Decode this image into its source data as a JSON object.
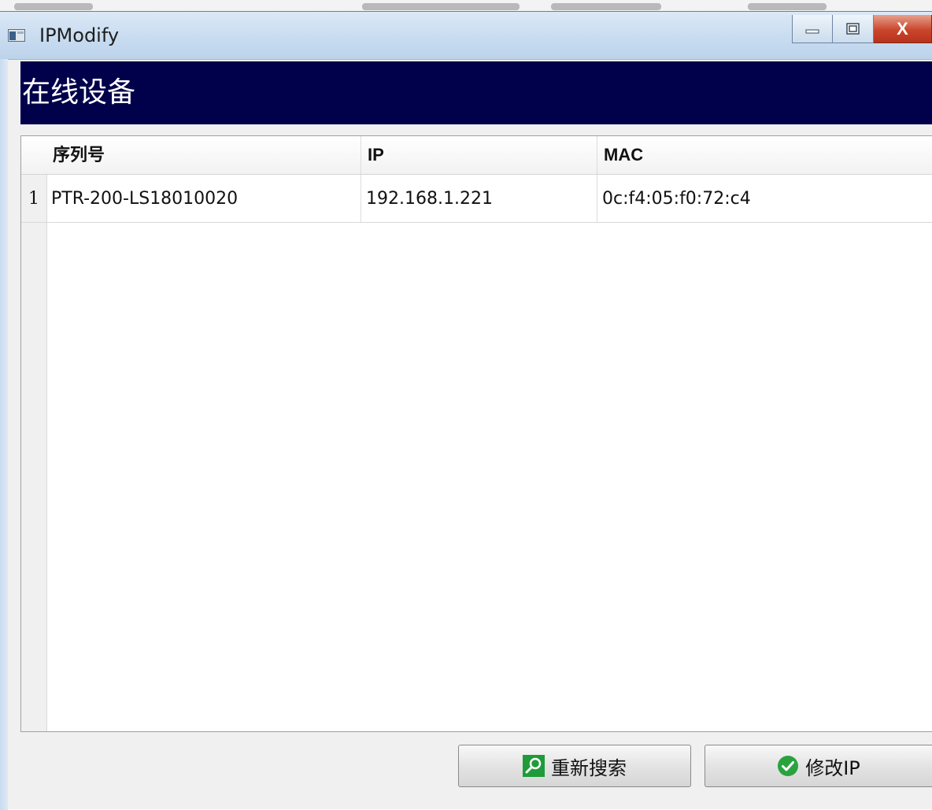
{
  "window": {
    "title": "IPModify",
    "close_glyph": "X"
  },
  "header": {
    "title": "在线设备"
  },
  "table": {
    "columns": [
      "序列号",
      "IP",
      "MAC"
    ],
    "rows": [
      {
        "index": "1",
        "serial": "PTR-200-LS18010020",
        "ip": "192.168.1.221",
        "mac": "0c:f4:05:f0:72:c4"
      }
    ]
  },
  "buttons": {
    "research_label": "重新搜索",
    "modify_label": "修改IP"
  },
  "colors": {
    "header_band": "#00004b",
    "search_icon": "#1f9b3a",
    "check_icon": "#2aa33f",
    "close_button": "#c9462c"
  },
  "icons": {
    "search": "search-icon",
    "check": "check-circle-icon",
    "app": "app-window-icon"
  }
}
